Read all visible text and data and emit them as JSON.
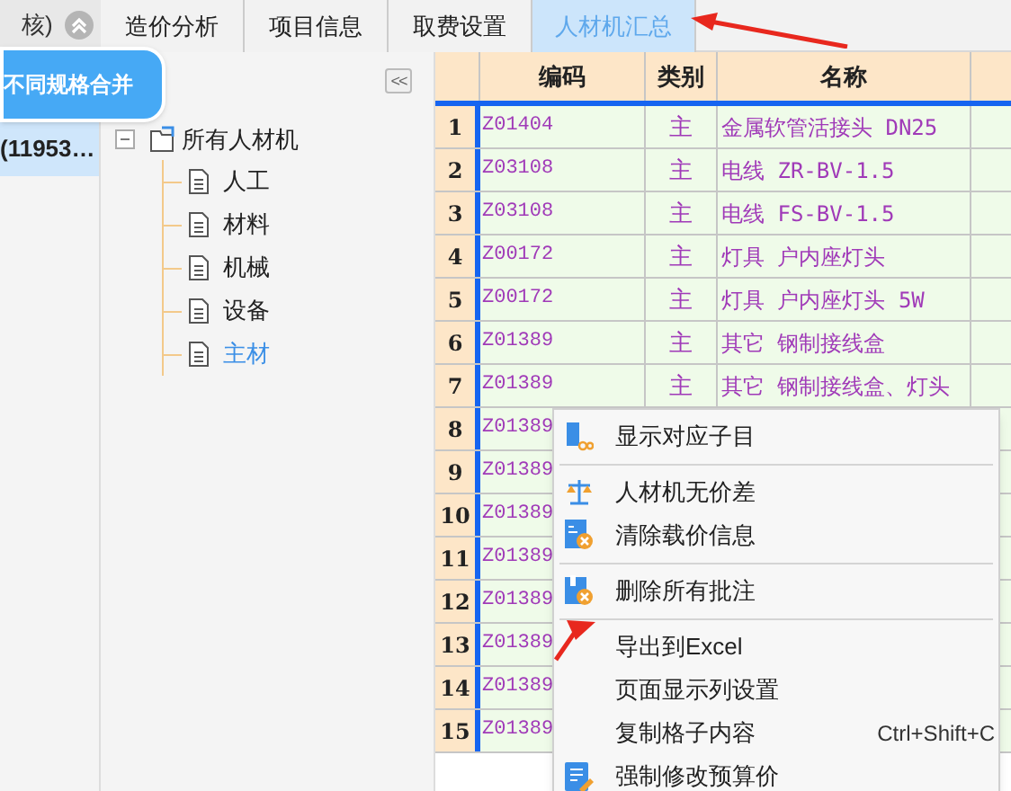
{
  "left_panel": {
    "title": "核)",
    "tooltip": "不同规格合并",
    "selected_item": "(11953…"
  },
  "tabs": [
    {
      "label": "造价分析",
      "selected": false
    },
    {
      "label": "项目信息",
      "selected": false
    },
    {
      "label": "取费设置",
      "selected": false
    },
    {
      "label": "人材机汇总",
      "selected": true
    }
  ],
  "collapse_button": "<<",
  "tree": {
    "label": "所有人材机",
    "expanded": true,
    "children": [
      {
        "label": "人工",
        "selected": false
      },
      {
        "label": "材料",
        "selected": false
      },
      {
        "label": "机械",
        "selected": false
      },
      {
        "label": "设备",
        "selected": false
      },
      {
        "label": "主材",
        "selected": true
      }
    ]
  },
  "table": {
    "columns": [
      "编码",
      "类别",
      "名称"
    ],
    "rows": [
      {
        "num": "1",
        "code": "Z01404",
        "category": "主",
        "name": "金属软管活接头 DN25"
      },
      {
        "num": "2",
        "code": "Z03108",
        "category": "主",
        "name": "电线 ZR-BV-1.5"
      },
      {
        "num": "3",
        "code": "Z03108",
        "category": "主",
        "name": "电线 FS-BV-1.5"
      },
      {
        "num": "4",
        "code": "Z00172",
        "category": "主",
        "name": "灯具 户内座灯头"
      },
      {
        "num": "5",
        "code": "Z00172",
        "category": "主",
        "name": "灯具 户内座灯头 5W"
      },
      {
        "num": "6",
        "code": "Z01389",
        "category": "主",
        "name": "其它 钢制接线盒"
      },
      {
        "num": "7",
        "code": "Z01389",
        "category": "主",
        "name": "其它 钢制接线盒、灯头"
      },
      {
        "num": "8",
        "code": "Z01389"
      },
      {
        "num": "9",
        "code": "Z01389"
      },
      {
        "num": "10",
        "code": "Z01389"
      },
      {
        "num": "11",
        "code": "Z01389"
      },
      {
        "num": "12",
        "code": "Z01389"
      },
      {
        "num": "13",
        "code": "Z01389"
      },
      {
        "num": "14",
        "code": "Z01389"
      },
      {
        "num": "15",
        "code": "Z01389"
      }
    ]
  },
  "context_menu": [
    {
      "kind": "item",
      "label": "显示对应子目"
    },
    {
      "kind": "separator"
    },
    {
      "kind": "item",
      "label": "人材机无价差"
    },
    {
      "kind": "item",
      "label": "清除载价信息"
    },
    {
      "kind": "separator"
    },
    {
      "kind": "item",
      "label": "删除所有批注"
    },
    {
      "kind": "separator"
    },
    {
      "kind": "item",
      "label": "导出到Excel"
    },
    {
      "kind": "item",
      "label": "页面显示列设置"
    },
    {
      "kind": "item",
      "label": "复制格子内容",
      "shortcut": "Ctrl+Shift+C"
    },
    {
      "kind": "item",
      "label": "强制修改预算价"
    }
  ]
}
